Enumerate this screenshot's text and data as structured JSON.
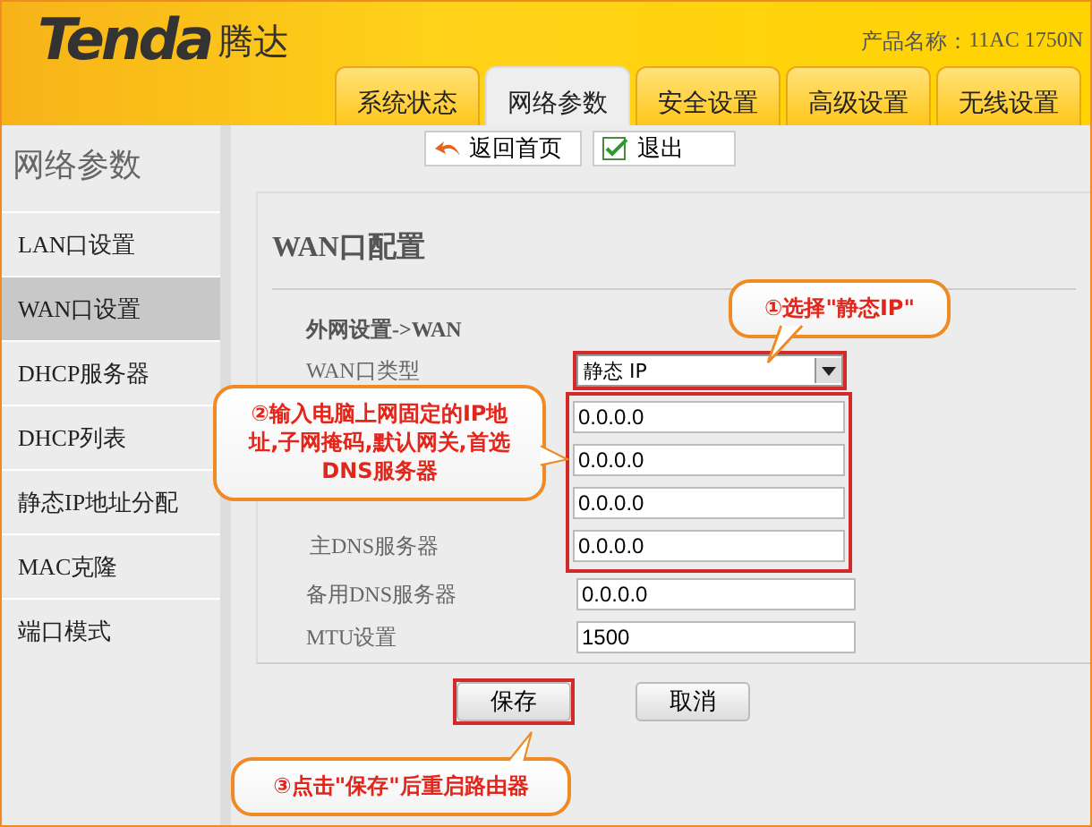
{
  "header": {
    "logo": "Tenda",
    "logo_cn": "腾达",
    "product_label": "产品名称：",
    "product_name": "11AC 1750N"
  },
  "tabs": [
    {
      "label": "系统状态",
      "selected": false
    },
    {
      "label": "网络参数",
      "selected": true
    },
    {
      "label": "安全设置",
      "selected": false
    },
    {
      "label": "高级设置",
      "selected": false
    },
    {
      "label": "无线设置",
      "selected": false
    }
  ],
  "sidebar": {
    "title": "网络参数",
    "items": [
      {
        "label": "LAN口设置",
        "selected": false
      },
      {
        "label": "WAN口设置",
        "selected": true
      },
      {
        "label": "DHCP服务器",
        "selected": false
      },
      {
        "label": "DHCP列表",
        "selected": false
      },
      {
        "label": "静态IP地址分配",
        "selected": false
      },
      {
        "label": "MAC克隆",
        "selected": false
      },
      {
        "label": "端口模式",
        "selected": false
      }
    ]
  },
  "toolbar": [
    {
      "label": "返回首页",
      "kind": "home"
    },
    {
      "label": "退出",
      "kind": "exit"
    }
  ],
  "panel": {
    "title": "WAN口配置",
    "section": "外网设置->WAN",
    "fields": [
      {
        "label": "WAN口类型",
        "kind": "select",
        "value": "静态 IP",
        "highlighted": true
      },
      {
        "kind": "text",
        "value": "0.0.0.0",
        "highlighted": true
      },
      {
        "kind": "text",
        "value": "0.0.0.0",
        "highlighted": true
      },
      {
        "kind": "text",
        "value": "0.0.0.0",
        "highlighted": true
      },
      {
        "label": "主DNS服务器",
        "kind": "text",
        "value": "0.0.0.0",
        "highlighted": true
      },
      {
        "label": "备用DNS服务器",
        "kind": "text",
        "value": "0.0.0.0",
        "highlighted": false
      },
      {
        "label": "MTU设置",
        "kind": "text",
        "value": "1500",
        "highlighted": false
      }
    ],
    "buttons": [
      {
        "label": "保存",
        "highlighted": true
      },
      {
        "label": "取消",
        "highlighted": false
      }
    ]
  },
  "callouts": [
    {
      "text": "①选择\"静态IP\"",
      "kind": "down"
    },
    {
      "text": "②输入电脑上网固定的IP地址,子网掩码,默认网关,首选DNS服务器",
      "kind": "right"
    },
    {
      "text": "③点击\"保存\"后重启路由器",
      "kind": "up"
    }
  ]
}
